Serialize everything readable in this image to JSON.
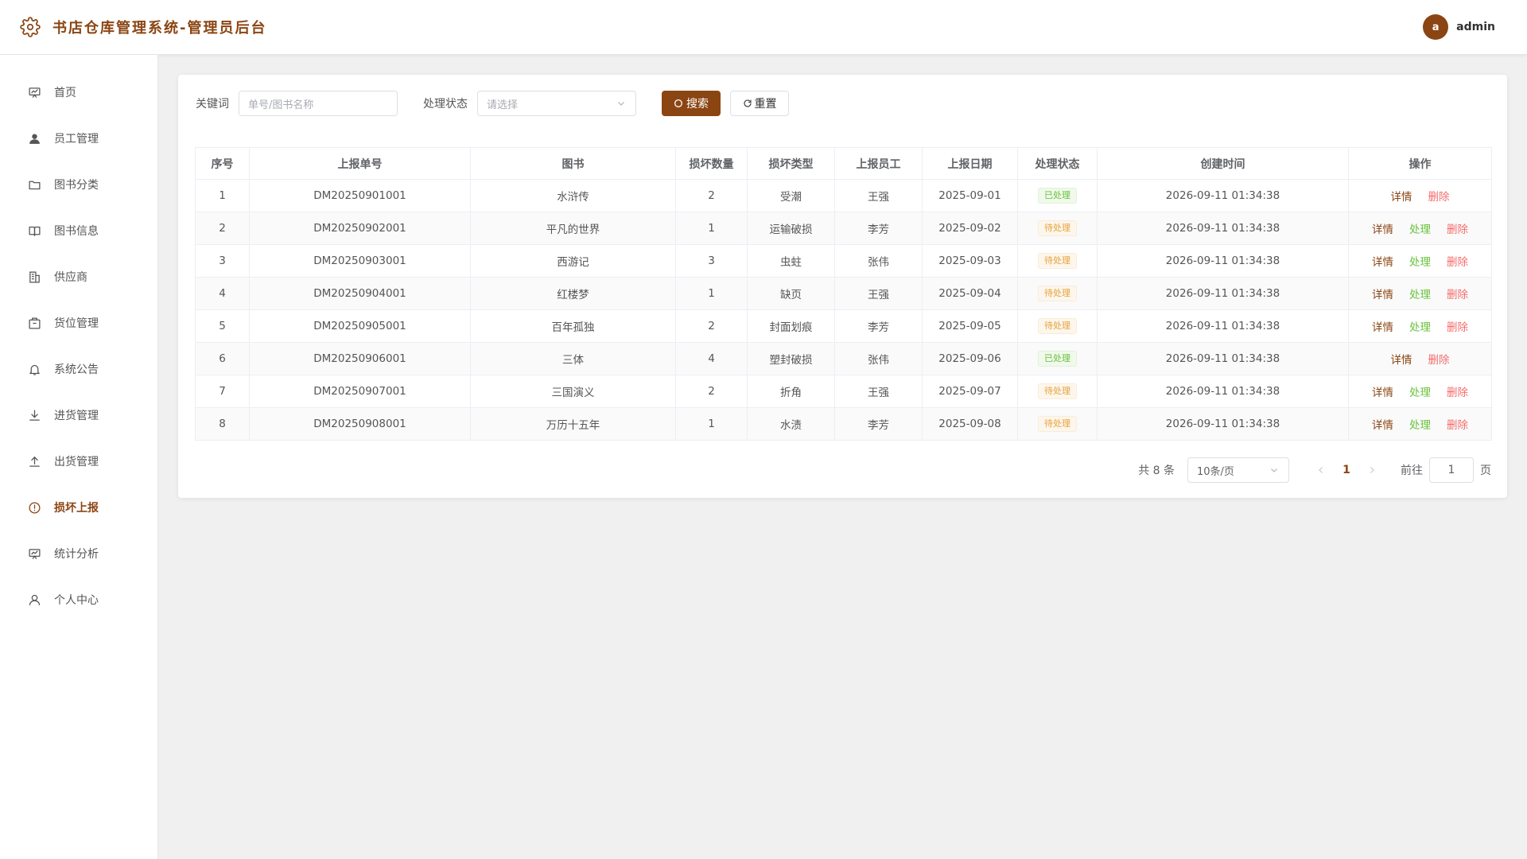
{
  "app": {
    "title": "书店仓库管理系统-管理员后台"
  },
  "user": {
    "avatar_letter": "a",
    "name": "admin"
  },
  "sidebar": {
    "items": [
      {
        "label": "首页",
        "icon": "presentation-board-icon"
      },
      {
        "label": "员工管理",
        "icon": "user-icon"
      },
      {
        "label": "图书分类",
        "icon": "folder-icon"
      },
      {
        "label": "图书信息",
        "icon": "book-icon"
      },
      {
        "label": "供应商",
        "icon": "building-icon"
      },
      {
        "label": "货位管理",
        "icon": "box-icon"
      },
      {
        "label": "系统公告",
        "icon": "bell-icon"
      },
      {
        "label": "进货管理",
        "icon": "download-icon"
      },
      {
        "label": "出货管理",
        "icon": "upload-icon"
      },
      {
        "label": "损坏上报",
        "icon": "warning-icon",
        "active": true
      },
      {
        "label": "统计分析",
        "icon": "chart-board-icon"
      },
      {
        "label": "个人中心",
        "icon": "person-icon"
      }
    ]
  },
  "search": {
    "keyword_label": "关键词",
    "keyword_placeholder": "单号/图书名称",
    "status_label": "处理状态",
    "status_placeholder": "请选择",
    "search_button": "搜索",
    "reset_button": "重置"
  },
  "table": {
    "columns": [
      "序号",
      "上报单号",
      "图书",
      "损坏数量",
      "损坏类型",
      "上报员工",
      "上报日期",
      "处理状态",
      "创建时间",
      "操作"
    ],
    "rows": [
      {
        "index": "1",
        "report_no": "DM20250901001",
        "book": "水浒传",
        "quantity": "2",
        "damage_type": "受潮",
        "employee": "王强",
        "date": "2025-09-01",
        "status": "已处理",
        "created": "2026-09-11 01:34:38"
      },
      {
        "index": "2",
        "report_no": "DM20250902001",
        "book": "平凡的世界",
        "quantity": "1",
        "damage_type": "运输破损",
        "employee": "李芳",
        "date": "2025-09-02",
        "status": "待处理",
        "created": "2026-09-11 01:34:38"
      },
      {
        "index": "3",
        "report_no": "DM20250903001",
        "book": "西游记",
        "quantity": "3",
        "damage_type": "虫蛀",
        "employee": "张伟",
        "date": "2025-09-03",
        "status": "待处理",
        "created": "2026-09-11 01:34:38"
      },
      {
        "index": "4",
        "report_no": "DM20250904001",
        "book": "红楼梦",
        "quantity": "1",
        "damage_type": "缺页",
        "employee": "王强",
        "date": "2025-09-04",
        "status": "待处理",
        "created": "2026-09-11 01:34:38"
      },
      {
        "index": "5",
        "report_no": "DM20250905001",
        "book": "百年孤独",
        "quantity": "2",
        "damage_type": "封面划痕",
        "employee": "李芳",
        "date": "2025-09-05",
        "status": "待处理",
        "created": "2026-09-11 01:34:38"
      },
      {
        "index": "6",
        "report_no": "DM20250906001",
        "book": "三体",
        "quantity": "4",
        "damage_type": "塑封破损",
        "employee": "张伟",
        "date": "2025-09-06",
        "status": "已处理",
        "created": "2026-09-11 01:34:38"
      },
      {
        "index": "7",
        "report_no": "DM20250907001",
        "book": "三国演义",
        "quantity": "2",
        "damage_type": "折角",
        "employee": "王强",
        "date": "2025-09-07",
        "status": "待处理",
        "created": "2026-09-11 01:34:38"
      },
      {
        "index": "8",
        "report_no": "DM20250908001",
        "book": "万历十五年",
        "quantity": "1",
        "damage_type": "水渍",
        "employee": "李芳",
        "date": "2025-09-08",
        "status": "待处理",
        "created": "2026-09-11 01:34:38"
      }
    ],
    "actions": {
      "detail": "详情",
      "handle": "处理",
      "delete": "删除"
    },
    "done_status": "已处理"
  },
  "pagination": {
    "total_text": "共 8 条",
    "page_size": "10条/页",
    "current_page": "1",
    "goto_label": "前往",
    "goto_value": "1",
    "goto_suffix": "页"
  },
  "colors": {
    "brand": "#8b4513",
    "success": "#67c23a",
    "warning": "#e6a23c",
    "danger": "#f56c6c"
  }
}
